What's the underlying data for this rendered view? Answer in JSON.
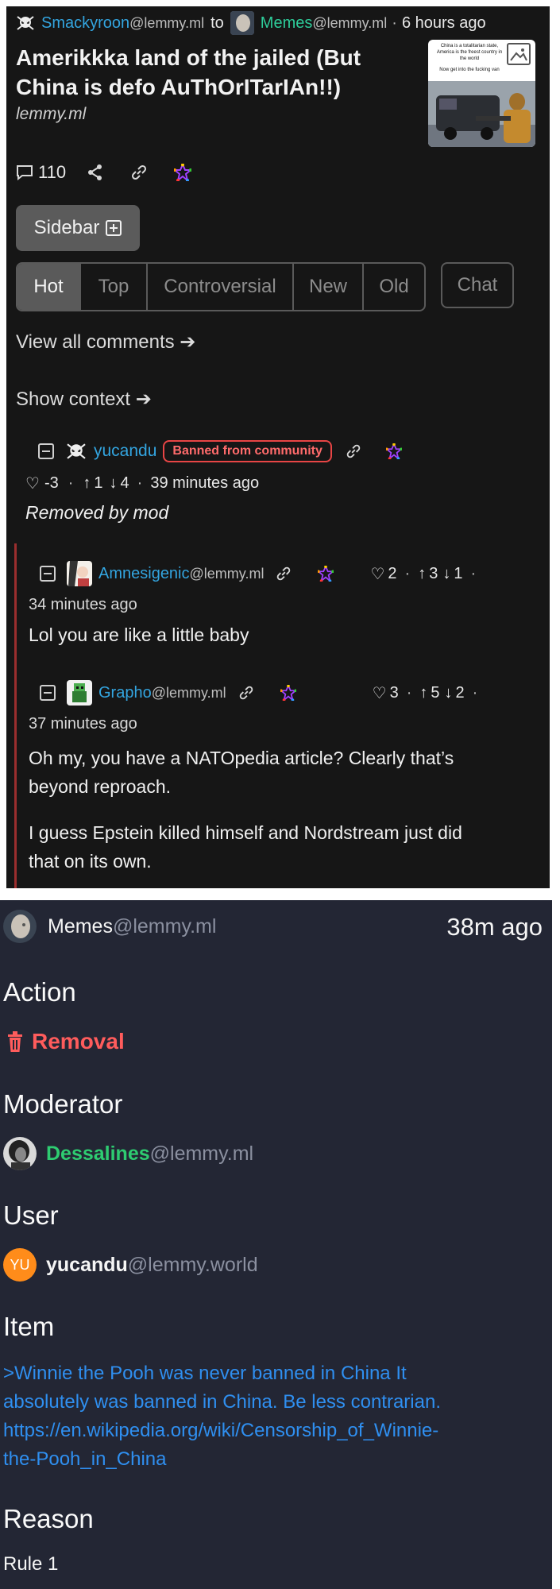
{
  "post": {
    "author_name": "Smackyroon",
    "author_instance": "@lemmy.ml",
    "to_word": "to",
    "community_name": "Memes",
    "community_instance": "@lemmy.ml",
    "time_sep": "·",
    "time": "6 hours ago",
    "title_line1": "Amerikkka land of the jailed (But",
    "title_line2": "China is defo AuThOrITarIAn!!)",
    "domain": "lemmy.ml",
    "thumbnail_line1": "China is a totalitarian state,",
    "thumbnail_line2": "America is the freest country in",
    "thumbnail_line3": "the world",
    "thumbnail_line4": "Now get into the fucking van",
    "comment_count": "110"
  },
  "controls": {
    "sidebar_label": "Sidebar",
    "sort_tabs": [
      {
        "label": "Hot",
        "active": true
      },
      {
        "label": "Top",
        "active": false
      },
      {
        "label": "Controversial",
        "active": false
      },
      {
        "label": "New",
        "active": false
      },
      {
        "label": "Old",
        "active": false
      }
    ],
    "chat_label": "Chat",
    "view_all_comments": "View all comments ➔",
    "show_context": "Show context ➔"
  },
  "comments": [
    {
      "user": "yucandu",
      "badge": "Banned from community",
      "likes": "-3",
      "up": "1",
      "down": "4",
      "time": "39 minutes ago",
      "body": "Removed by mod"
    },
    {
      "user": "Amnesigenic",
      "instance": "@lemmy.ml",
      "likes": "2",
      "up": "3",
      "down": "1",
      "time": "34 minutes ago",
      "body": "Lol you are like a little baby"
    },
    {
      "user": "Grapho",
      "instance": "@lemmy.ml",
      "likes": "3",
      "up": "5",
      "down": "2",
      "time": "37 minutes ago",
      "body_p1_line1": "Oh my, you have a NATOpedia article? Clearly that’s",
      "body_p1_line2": "beyond reproach.",
      "body_p2_line1": "I guess Epstein killed himself and Nordstream just did",
      "body_p2_line2": "that on its own."
    }
  ],
  "modlog": {
    "community_name": "Memes",
    "community_instance": "@lemmy.ml",
    "time": "38m ago",
    "action_heading": "Action",
    "action_value": "Removal",
    "moderator_heading": "Moderator",
    "moderator_name": "Dessalines",
    "moderator_instance": "@lemmy.ml",
    "user_heading": "User",
    "user_initials": "YU",
    "user_name": "yucandu",
    "user_instance": "@lemmy.world",
    "item_heading": "Item",
    "item_line1": ">Winnie the Pooh was never banned in China It",
    "item_line2": "absolutely was banned in China. Be less contrarian.",
    "item_line3": "https://en.wikipedia.org/wiki/Censorship_of_Winnie-",
    "item_line4": "the-Pooh_in_China",
    "reason_heading": "Reason",
    "reason_value": "Rule 1"
  },
  "colors": {
    "post_bg": "#161616",
    "modlog_bg": "#232634",
    "username_blue": "#33a5e0",
    "community_green": "#2ecc9a",
    "removal_red": "#ff5c5c",
    "badge_red": "#e84545",
    "link_blue": "#2f8ff0"
  }
}
